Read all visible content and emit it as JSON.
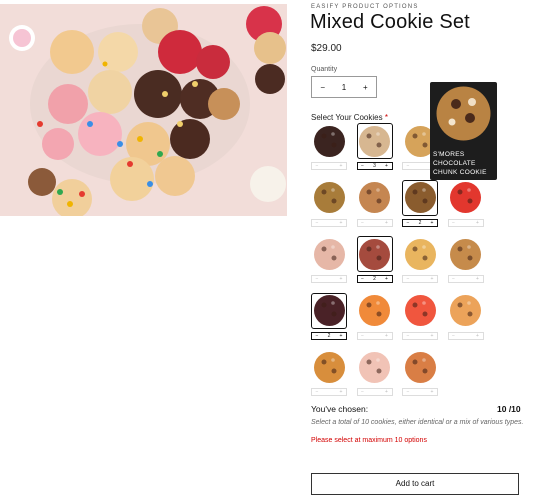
{
  "product": {
    "vendor": "EASIFY PRODUCT OPTIONS",
    "title": "Mixed Cookie Set",
    "price": "$29.00",
    "quantity_label": "Quantity",
    "quantity_value": "1",
    "minus": "−",
    "plus": "+"
  },
  "options": {
    "label": "Select Your Cookies",
    "required_mark": "*",
    "tooltip": "S'MORES CHOCOLATE CHUNK COOKIE",
    "cookies": [
      {
        "color": "#3b2420",
        "qty": "",
        "selected": false
      },
      {
        "color": "#d7b791",
        "qty": "3",
        "selected": true
      },
      {
        "color": "#d6a35a",
        "qty": "",
        "selected": false
      },
      {
        "color": "#e07a32",
        "qty": "1",
        "selected": true
      },
      {
        "color": "#a87c3a",
        "qty": "",
        "selected": false
      },
      {
        "color": "#c58651",
        "qty": "",
        "selected": false
      },
      {
        "color": "#8a5c2e",
        "qty": "2",
        "selected": true
      },
      {
        "color": "#e2372e",
        "qty": "",
        "selected": false
      },
      {
        "color": "#e6b7a7",
        "qty": "",
        "selected": false
      },
      {
        "color": "#a54b3e",
        "qty": "2",
        "selected": true
      },
      {
        "color": "#e9b55f",
        "qty": "",
        "selected": false
      },
      {
        "color": "#c68b4b",
        "qty": "",
        "selected": false
      },
      {
        "color": "#4a2227",
        "qty": "2",
        "selected": true
      },
      {
        "color": "#f08a3a",
        "qty": "",
        "selected": false
      },
      {
        "color": "#f0563e",
        "qty": "",
        "selected": false
      },
      {
        "color": "#eca35a",
        "qty": "",
        "selected": false
      },
      {
        "color": "#d88e3c",
        "qty": "",
        "selected": false
      },
      {
        "color": "#f1c3b6",
        "qty": "",
        "selected": false
      },
      {
        "color": "#d97e45",
        "qty": "",
        "selected": false
      }
    ]
  },
  "summary": {
    "chosen_label": "You've chosen:",
    "chosen_count": "10 /10",
    "hint": "Select a total of 10 cookies, either identical or a mix of various types.",
    "error": "Please select at maximum 10 options"
  },
  "cart": {
    "label": "Add to cart"
  }
}
